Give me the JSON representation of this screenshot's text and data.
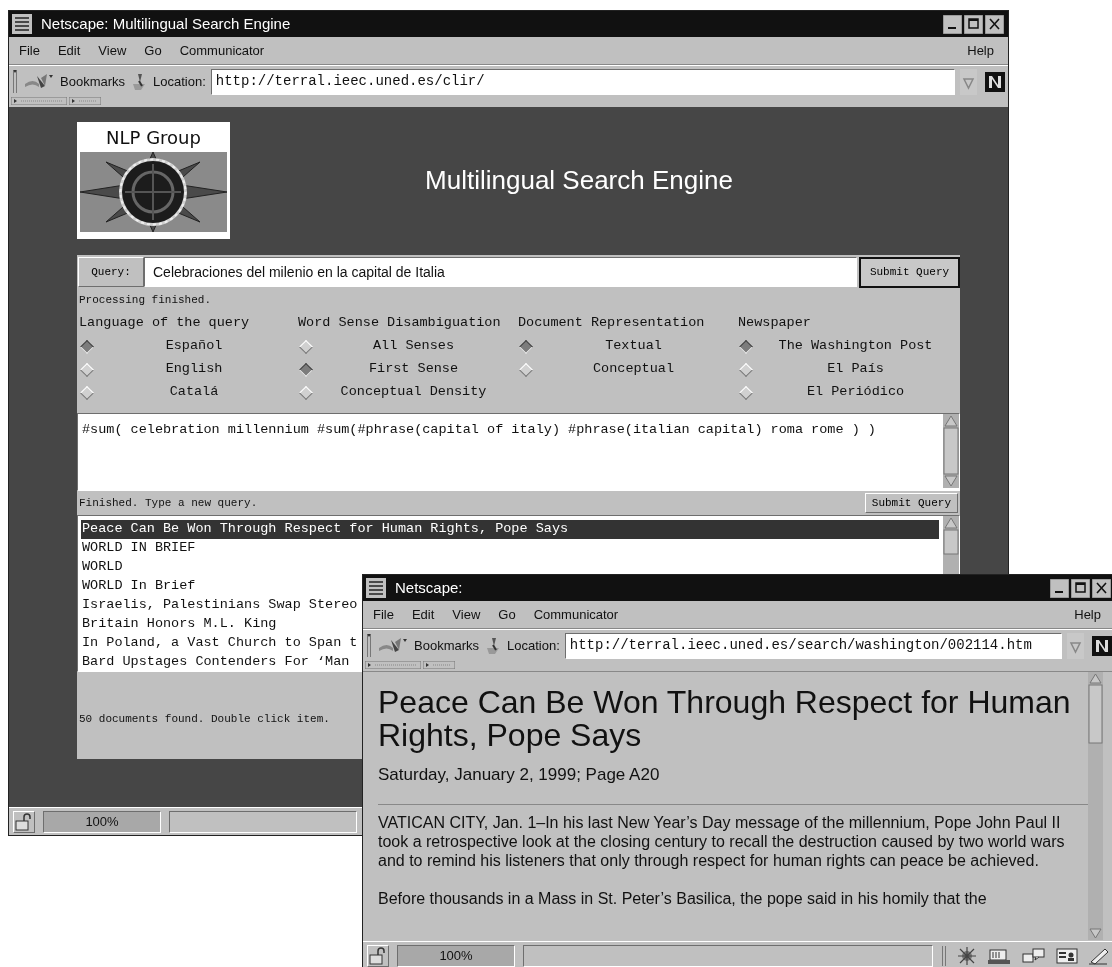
{
  "main_window": {
    "title": "Netscape: Multilingual Search Engine",
    "menu": [
      "File",
      "Edit",
      "View",
      "Go",
      "Communicator"
    ],
    "help_menu": "Help",
    "bookmarks_label": "Bookmarks",
    "location_label": "Location:",
    "url": "http://terral.ieec.uned.es/clir/",
    "logo_caption": "NLP Group",
    "page_title": "Multilingual Search Engine",
    "query_label": "Query:",
    "query_value": "Celebraciones del milenio en la capital de Italia",
    "submit_button": "Submit Query",
    "processing_status": "Processing finished.",
    "option_groups": [
      {
        "heading": "Language of the query",
        "options": [
          {
            "label": "Español",
            "selected": true
          },
          {
            "label": "English",
            "selected": false
          },
          {
            "label": "Catalá",
            "selected": false
          }
        ]
      },
      {
        "heading": "Word Sense Disambiguation",
        "options": [
          {
            "label": "All Senses",
            "selected": false
          },
          {
            "label": "First Sense",
            "selected": true
          },
          {
            "label": "Conceptual Density",
            "selected": false
          }
        ]
      },
      {
        "heading": "Document Representation",
        "options": [
          {
            "label": "Textual",
            "selected": true
          },
          {
            "label": "Conceptual",
            "selected": false
          }
        ]
      },
      {
        "heading": "Newspaper",
        "options": [
          {
            "label": "The Washington Post",
            "selected": true
          },
          {
            "label": "El País",
            "selected": false
          },
          {
            "label": "El Periódico",
            "selected": false
          }
        ]
      }
    ],
    "expanded_query": "#sum( celebration millennium #sum(#phrase(capital of italy) #phrase(italian capital) roma rome ) )",
    "query_status": "Finished. Type a new query.",
    "submit_button_2": "Submit Query",
    "results": [
      {
        "text": "Peace Can Be Won Through Respect for Human Rights, Pope Says",
        "selected": true
      },
      {
        "text": "WORLD IN BRIEF",
        "selected": false
      },
      {
        "text": "WORLD",
        "selected": false
      },
      {
        "text": "WORLD In Brief",
        "selected": false
      },
      {
        "text": "Israelis, Palestinians Swap Stereo",
        "selected": false
      },
      {
        "text": "Britain Honors M.L. King",
        "selected": false
      },
      {
        "text": "In Poland, a Vast Church to Span t",
        "selected": false
      },
      {
        "text": "Bard Upstages Contenders For ‘Man",
        "selected": false
      }
    ],
    "results_status": "50 documents found. Double click item.",
    "zoom": "100%"
  },
  "article_window": {
    "title": "Netscape:",
    "menu": [
      "File",
      "Edit",
      "View",
      "Go",
      "Communicator"
    ],
    "help_menu": "Help",
    "bookmarks_label": "Bookmarks",
    "location_label": "Location:",
    "url": "http://terral.ieec.uned.es/search/washington/002114.htm",
    "headline": "Peace Can Be Won Through Respect for Human Rights, Pope Says",
    "dateline": "Saturday, January 2, 1999; Page A20",
    "paragraphs": [
      "VATICAN CITY, Jan. 1–In his last New Year’s Day message of the millennium, Pope John Paul II took a retrospective look at the closing century to recall the destruction caused by two world wars and to remind his listeners that only through respect for human rights can peace be achieved.",
      "Before thousands in a Mass in St. Peter’s Basilica, the pope said in his homily that the"
    ],
    "zoom": "100%"
  }
}
